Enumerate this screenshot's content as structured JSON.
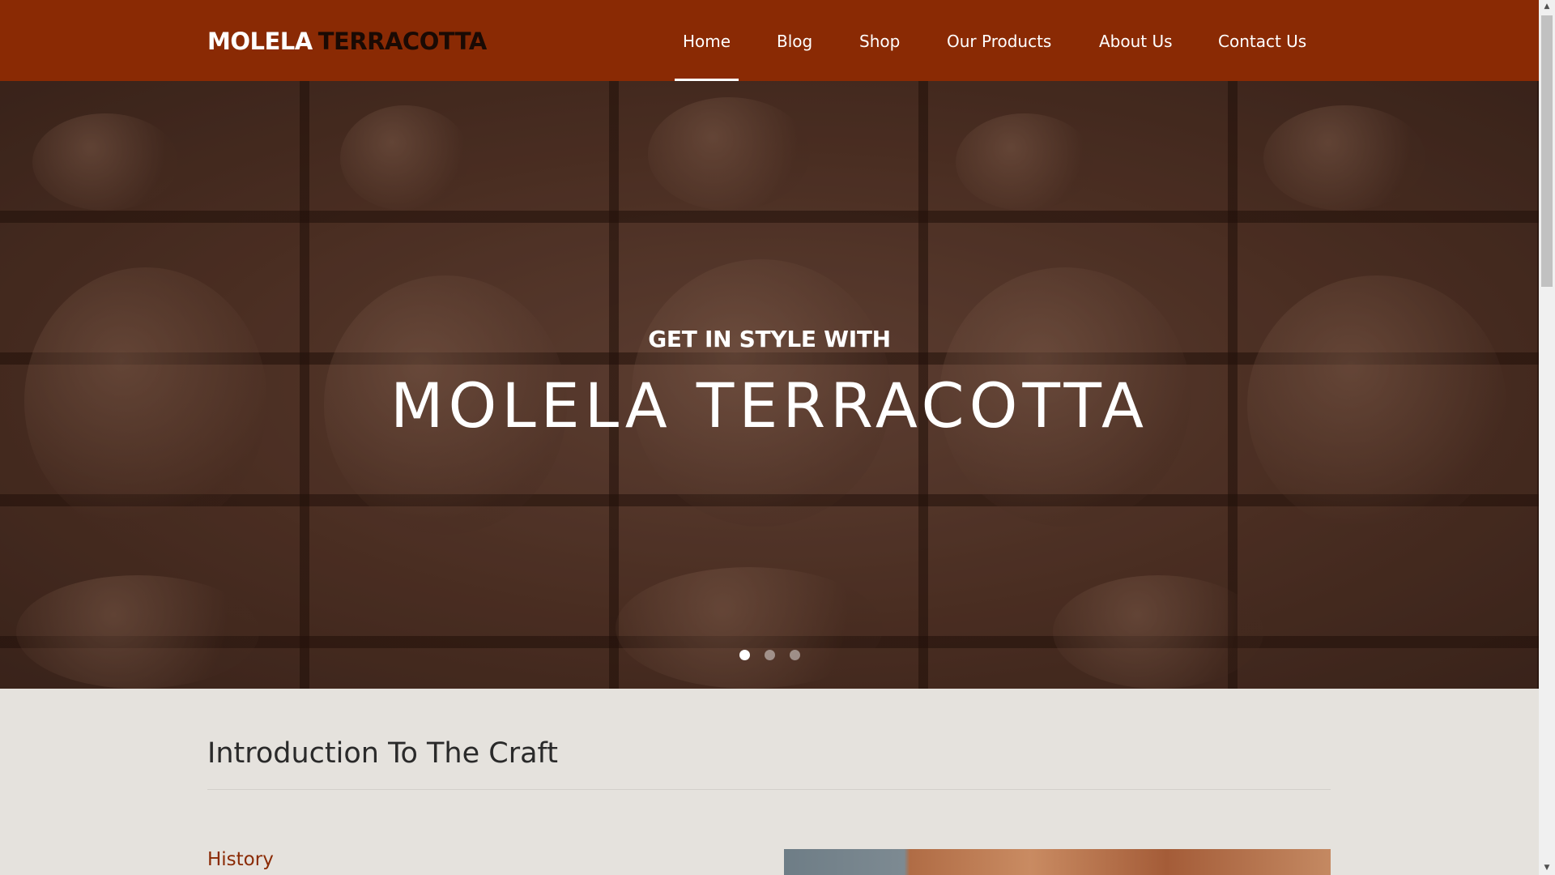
{
  "header": {
    "logo_part1": "MOLELA",
    "logo_part2": "TERRACOTTA",
    "nav": [
      {
        "label": "Home",
        "active": true
      },
      {
        "label": "Blog",
        "active": false
      },
      {
        "label": "Shop",
        "active": false
      },
      {
        "label": "Our Products",
        "active": false
      },
      {
        "label": "About Us",
        "active": false
      },
      {
        "label": "Contact Us",
        "active": false
      }
    ]
  },
  "hero": {
    "subtitle": "GET IN STYLE WITH",
    "title": "MOLELA TERRACOTTA",
    "slides_total": 3,
    "active_slide": 1
  },
  "intro": {
    "title": "Introduction To The Craft",
    "history_label": "History"
  },
  "colors": {
    "brand": "#8a2a04",
    "background": "#e5e2dd"
  },
  "icons": {
    "scroll_up": "▲",
    "scroll_down": "▼"
  }
}
